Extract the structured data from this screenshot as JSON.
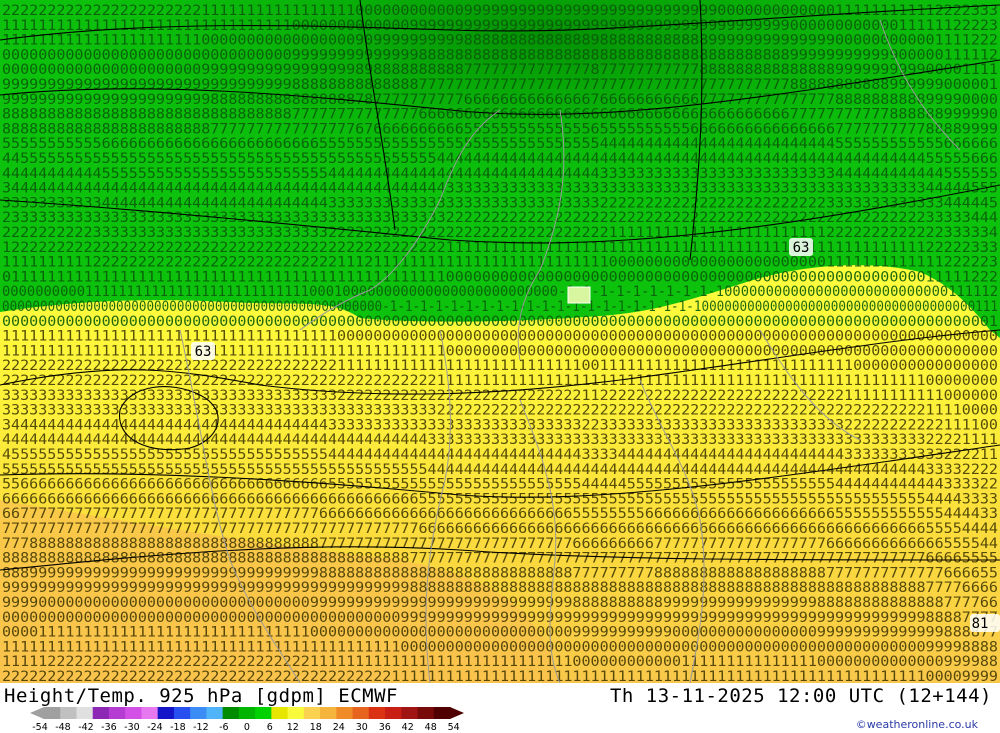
{
  "header": {
    "title_left": "Height/Temp. 925 hPa [gdpm] ECMWF",
    "title_right": "Th 13-11-2025 12:00 UTC (12+144)"
  },
  "credit": "©weatheronline.co.uk",
  "station_labels": [
    "63",
    "63",
    "81"
  ],
  "colorbar": {
    "ticks": [
      "-54",
      "-48",
      "-42",
      "-36",
      "-30",
      "-24",
      "-18",
      "-12",
      "-6",
      "0",
      "6",
      "12",
      "18",
      "24",
      "30",
      "36",
      "42",
      "48",
      "54"
    ],
    "colors": [
      "#a0a0a0",
      "#c0c0c0",
      "#e0e0e0",
      "#8c28b4",
      "#b43cd2",
      "#d250e6",
      "#e678f0",
      "#1414c8",
      "#2850f0",
      "#3c8cf5",
      "#50b4fa",
      "#008c00",
      "#00b400",
      "#00d200",
      "#e6e600",
      "#fafa3c",
      "#fad250",
      "#f5b43c",
      "#f08c28",
      "#e6641e",
      "#dc3214",
      "#c81e14",
      "#a01414",
      "#780a0a",
      "#500000"
    ]
  },
  "colors": {
    "green_dark": "#06a806",
    "green_mid": "#0cc20c",
    "yellow_light": "#fefe3c",
    "yellow_mid": "#fbe03a",
    "orange_light": "#fad04a",
    "contour": "#000000",
    "border": "#9a9a9a"
  }
}
